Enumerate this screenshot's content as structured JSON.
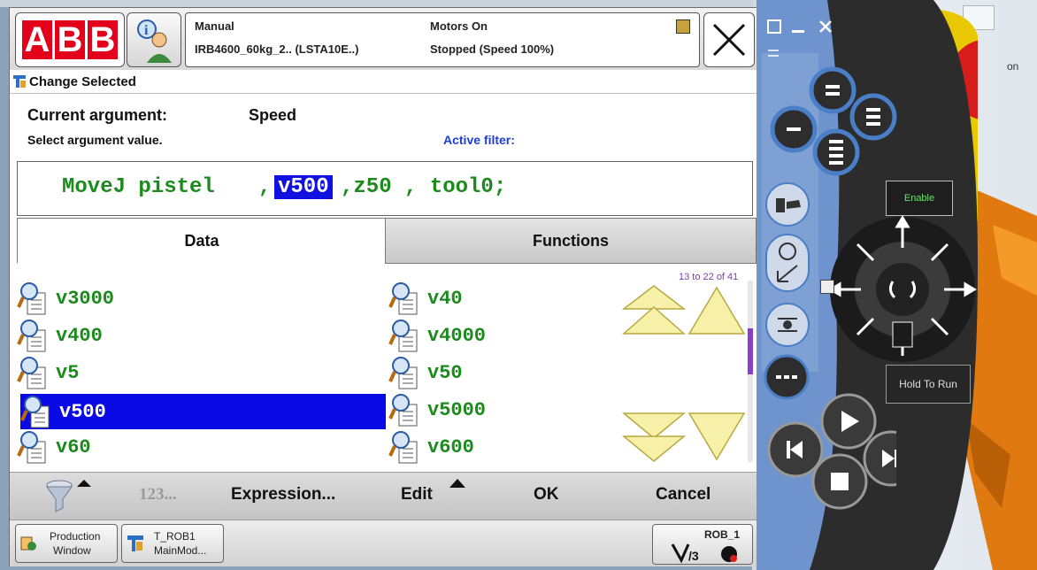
{
  "header": {
    "logo": "ABB",
    "mode": "Manual",
    "controller": "IRB4600_60kg_2.. (LSTA10E..)",
    "motors": "Motors On",
    "status": "Stopped (Speed 100%)",
    "close_label": "X"
  },
  "sub_header": {
    "title": "Change Selected"
  },
  "argument": {
    "current_label": "Current argument:",
    "current_value": "Speed",
    "instruction": "Select argument value.",
    "filter_label": "Active filter:"
  },
  "code": {
    "instr": "MoveJ pistel",
    "sep1": ",",
    "selected": "v500",
    "rest": ",z50 , tool0;"
  },
  "tabs": [
    {
      "label": "Data"
    },
    {
      "label": "Functions"
    }
  ],
  "list": {
    "range": "13 to 22 of 41",
    "col1": [
      "v3000",
      "v400",
      "v5",
      "v500",
      "v60"
    ],
    "col2": [
      "v40",
      "v4000",
      "v50",
      "v5000",
      "v600"
    ],
    "selected": "v500"
  },
  "commands": {
    "numeric": "123...",
    "expression": "Expression...",
    "edit": "Edit",
    "ok": "OK",
    "cancel": "Cancel"
  },
  "taskbar": {
    "production_l1": "Production",
    "production_l2": "Window",
    "task_l1": "T_ROB1",
    "task_l2": "MainMod...",
    "rob": "ROB_1"
  },
  "jog_panel": {
    "enable_label": "Enable",
    "hold_label": "Hold To Run",
    "colors": {
      "ring": "#4a7fc8",
      "body": "#2b2b2b",
      "estop": "#d81b1b",
      "yellow": "#f0d000"
    }
  }
}
